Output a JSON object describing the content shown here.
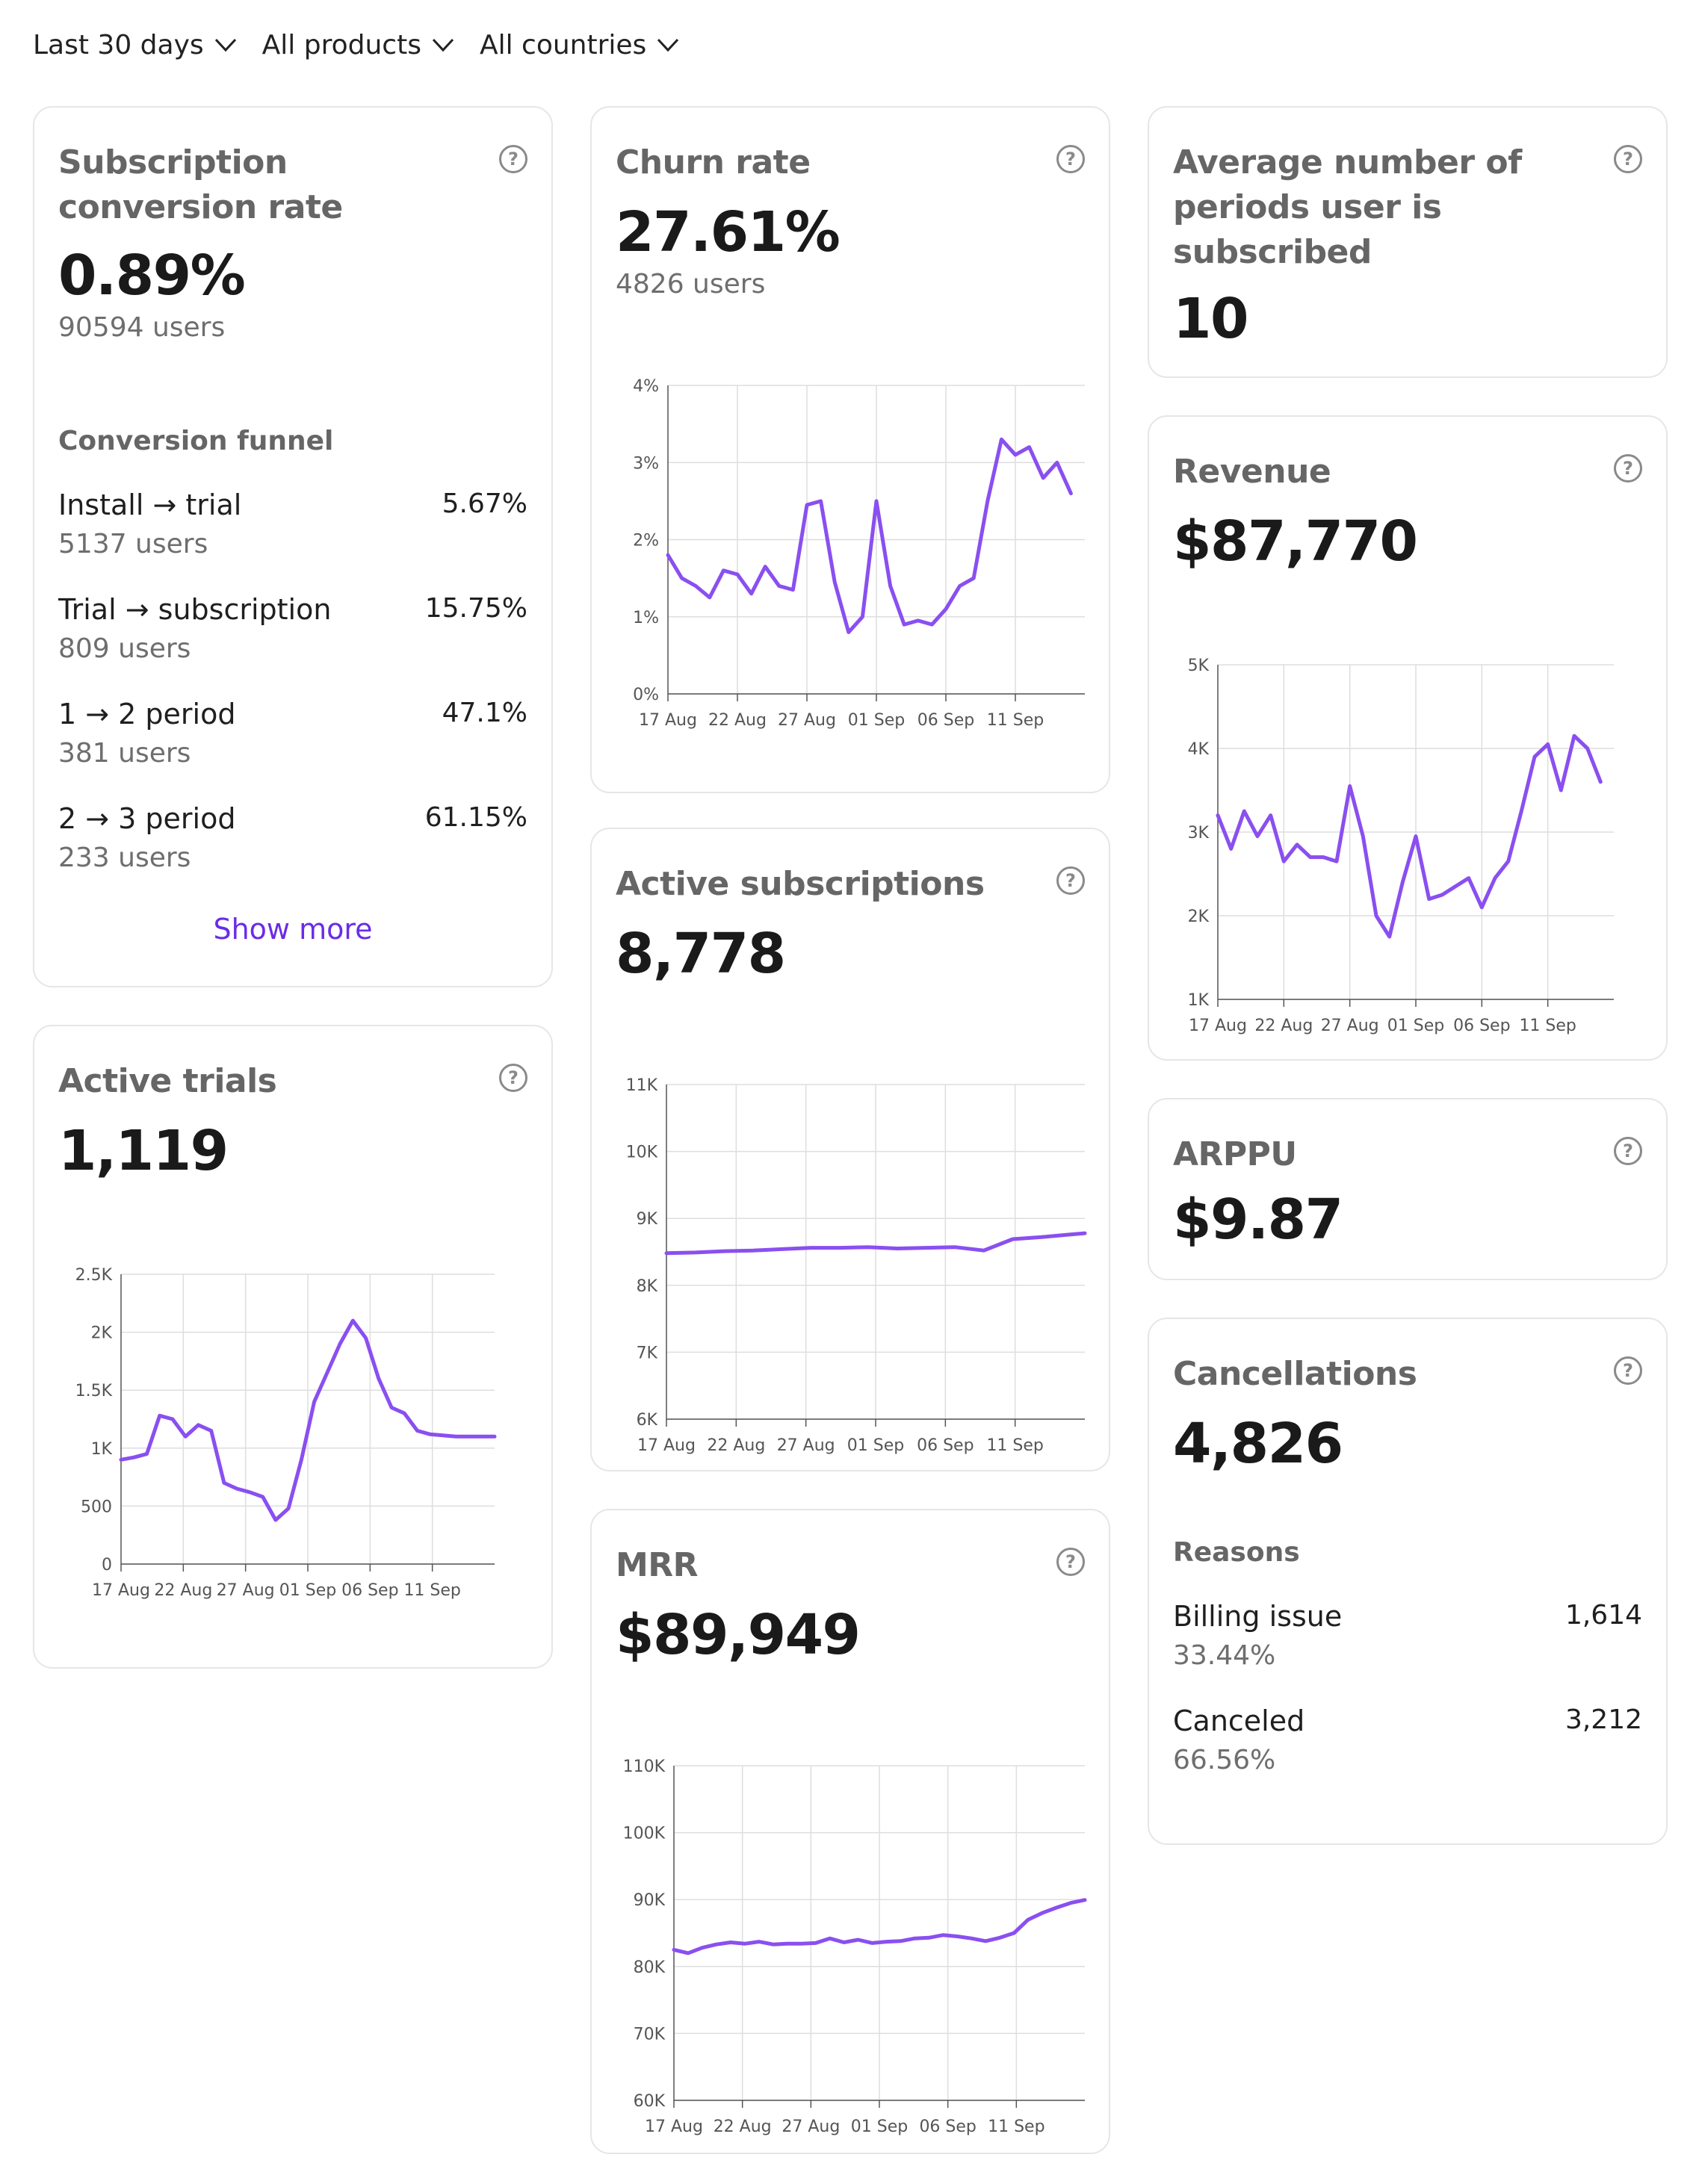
{
  "filters": [
    {
      "label": "Last 30 days"
    },
    {
      "label": "All products"
    },
    {
      "label": "All countries"
    }
  ],
  "x_ticks": [
    "17 Aug",
    "22 Aug",
    "27 Aug",
    "01 Sep",
    "06 Sep",
    "11 Sep"
  ],
  "conversion": {
    "title": "Subscription conversion rate",
    "value": "0.89%",
    "users": "90594 users",
    "funnel_title": "Conversion funnel",
    "funnel": [
      {
        "label": "Install → trial",
        "value": "5.67%",
        "users": "5137 users"
      },
      {
        "label": "Trial → subscription",
        "value": "15.75%",
        "users": "809 users"
      },
      {
        "label": "1 → 2 period",
        "value": "47.1%",
        "users": "381 users"
      },
      {
        "label": "2 → 3 period",
        "value": "61.15%",
        "users": "233 users"
      }
    ],
    "show_more": "Show more"
  },
  "active_trials": {
    "title": "Active trials",
    "value": "1,119"
  },
  "churn": {
    "title": "Churn rate",
    "value": "27.61%",
    "users": "4826 users"
  },
  "active_subscriptions": {
    "title": "Active subscriptions",
    "value": "8,778"
  },
  "mrr": {
    "title": "MRR",
    "value": "$89,949"
  },
  "avg_periods": {
    "title": "Average number of periods user is subscribed",
    "value": "10"
  },
  "revenue": {
    "title": "Revenue",
    "value": "$87,770"
  },
  "arppu": {
    "title": "ARPPU",
    "value": "$9.87"
  },
  "cancellations": {
    "title": "Cancellations",
    "value": "4,826",
    "reasons_title": "Reasons",
    "reasons": [
      {
        "label": "Billing issue",
        "value": "1,614",
        "share": "33.44%"
      },
      {
        "label": "Canceled",
        "value": "3,212",
        "share": "66.56%"
      }
    ]
  },
  "help_icon": "question-circle-icon",
  "colors": {
    "accent": "#8a4ff0",
    "link": "#6a2ce8"
  },
  "chart_data": [
    {
      "id": "churn",
      "type": "line",
      "y_ticks": [
        "0%",
        "1%",
        "2%",
        "3%",
        "4%"
      ],
      "ylim": [
        0,
        4
      ],
      "x_range": [
        0,
        30
      ],
      "x": [
        0,
        1,
        2,
        3,
        4,
        5,
        6,
        7,
        8,
        9,
        10,
        11,
        12,
        13,
        14,
        15,
        16,
        17,
        18,
        19,
        20,
        21,
        22,
        23,
        24,
        25,
        26,
        27,
        28,
        29
      ],
      "y": [
        1.8,
        1.5,
        1.4,
        1.25,
        1.6,
        1.55,
        1.3,
        1.65,
        1.4,
        1.35,
        2.45,
        2.5,
        1.45,
        0.8,
        1.0,
        2.5,
        1.4,
        0.9,
        0.95,
        0.9,
        1.1,
        1.4,
        1.5,
        2.5,
        3.3,
        3.1,
        3.2,
        2.8,
        3.0,
        2.6
      ]
    },
    {
      "id": "active_trials",
      "type": "line",
      "y_ticks": [
        "0",
        "500",
        "1K",
        "1.5K",
        "2K",
        "2.5K"
      ],
      "ylim": [
        0,
        2500
      ],
      "x_range": [
        0,
        29
      ],
      "x": [
        0,
        1,
        2,
        3,
        4,
        5,
        6,
        7,
        8,
        9,
        10,
        11,
        12,
        13,
        14,
        15,
        16,
        17,
        18,
        19,
        20,
        21,
        22,
        23,
        24,
        25,
        26,
        27,
        28,
        29
      ],
      "y": [
        900,
        920,
        950,
        1280,
        1250,
        1100,
        1200,
        1150,
        700,
        650,
        620,
        580,
        380,
        480,
        900,
        1400,
        1650,
        1900,
        2100,
        1950,
        1600,
        1350,
        1300,
        1150,
        1119,
        1110,
        1100,
        1100,
        1100,
        1100
      ]
    },
    {
      "id": "active_subscriptions",
      "type": "line",
      "y_ticks": [
        "6K",
        "7K",
        "8K",
        "9K",
        "10K",
        "11K"
      ],
      "ylim": [
        6000,
        11000
      ],
      "x_range": [
        0,
        29
      ],
      "x": [
        0,
        2,
        4,
        6,
        8,
        10,
        12,
        14,
        16,
        18,
        20,
        22,
        24,
        26,
        28,
        29
      ],
      "y": [
        8480,
        8490,
        8510,
        8520,
        8540,
        8560,
        8560,
        8570,
        8550,
        8560,
        8570,
        8520,
        8690,
        8720,
        8760,
        8778
      ]
    },
    {
      "id": "mrr",
      "type": "line",
      "y_ticks": [
        "60K",
        "70K",
        "80K",
        "90K",
        "100K",
        "110K"
      ],
      "ylim": [
        60000,
        110000
      ],
      "x_range": [
        0,
        29
      ],
      "x": [
        0,
        1,
        2,
        3,
        4,
        5,
        6,
        7,
        8,
        9,
        10,
        11,
        12,
        13,
        14,
        15,
        16,
        17,
        18,
        19,
        20,
        21,
        22,
        23,
        24,
        25,
        26,
        27,
        28,
        29
      ],
      "y": [
        82500,
        82000,
        82800,
        83300,
        83600,
        83400,
        83700,
        83300,
        83400,
        83400,
        83500,
        84200,
        83600,
        84000,
        83500,
        83700,
        83800,
        84200,
        84300,
        84700,
        84500,
        84200,
        83800,
        84300,
        85000,
        87000,
        88000,
        88800,
        89500,
        89949
      ]
    },
    {
      "id": "revenue",
      "type": "line",
      "y_ticks": [
        "1K",
        "2K",
        "3K",
        "4K",
        "5K"
      ],
      "ylim": [
        1000,
        5000
      ],
      "x_range": [
        0,
        30
      ],
      "x": [
        0,
        1,
        2,
        3,
        4,
        5,
        6,
        7,
        8,
        9,
        10,
        11,
        12,
        13,
        14,
        15,
        16,
        17,
        18,
        19,
        20,
        21,
        22,
        23,
        24,
        25,
        26,
        27,
        28,
        29
      ],
      "y": [
        3200,
        2800,
        3250,
        2950,
        3200,
        2650,
        2850,
        2700,
        2700,
        2650,
        3550,
        2950,
        2000,
        1750,
        2400,
        2950,
        2200,
        2250,
        2350,
        2450,
        2100,
        2450,
        2650,
        3250,
        3900,
        4050,
        3500,
        4150,
        4000,
        3600
      ]
    }
  ]
}
